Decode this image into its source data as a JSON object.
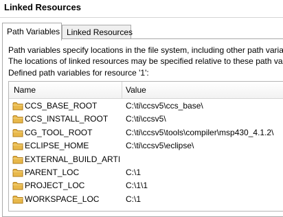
{
  "window": {
    "title": "Linked Resources"
  },
  "tabs": [
    {
      "label": "Path Variables",
      "active": true
    },
    {
      "label": "Linked Resources",
      "active": false
    }
  ],
  "description": {
    "line1": "Path variables specify locations in the file system, including other path variab",
    "line2": "The locations of linked resources may be specified relative to these path varia"
  },
  "defined_label": "Defined path variables for resource '1':",
  "table": {
    "columns": [
      "Name",
      "Value"
    ],
    "rows": [
      {
        "name": "CCS_BASE_ROOT",
        "value": "C:\\ti\\ccsv5\\ccs_base\\",
        "icon": "folder-icon"
      },
      {
        "name": "CCS_INSTALL_ROOT",
        "value": "C:\\ti\\ccsv5\\",
        "icon": "folder-icon"
      },
      {
        "name": "CG_TOOL_ROOT",
        "value": "C:\\ti\\ccsv5\\tools\\compiler\\msp430_4.1.2\\",
        "icon": "folder-icon"
      },
      {
        "name": "ECLIPSE_HOME",
        "value": "C:\\ti\\ccsv5\\eclipse\\",
        "icon": "folder-icon"
      },
      {
        "name": "EXTERNAL_BUILD_ARTI...",
        "value": "",
        "icon": "folder-icon"
      },
      {
        "name": "PARENT_LOC",
        "value": "C:\\1",
        "icon": "folder-icon"
      },
      {
        "name": "PROJECT_LOC",
        "value": "C:\\1\\1",
        "icon": "folder-icon"
      },
      {
        "name": "WORKSPACE_LOC",
        "value": "C:\\1",
        "icon": "folder-icon"
      }
    ]
  },
  "colors": {
    "folder_fill": "#e8b84a",
    "folder_stroke": "#b07c1a"
  }
}
